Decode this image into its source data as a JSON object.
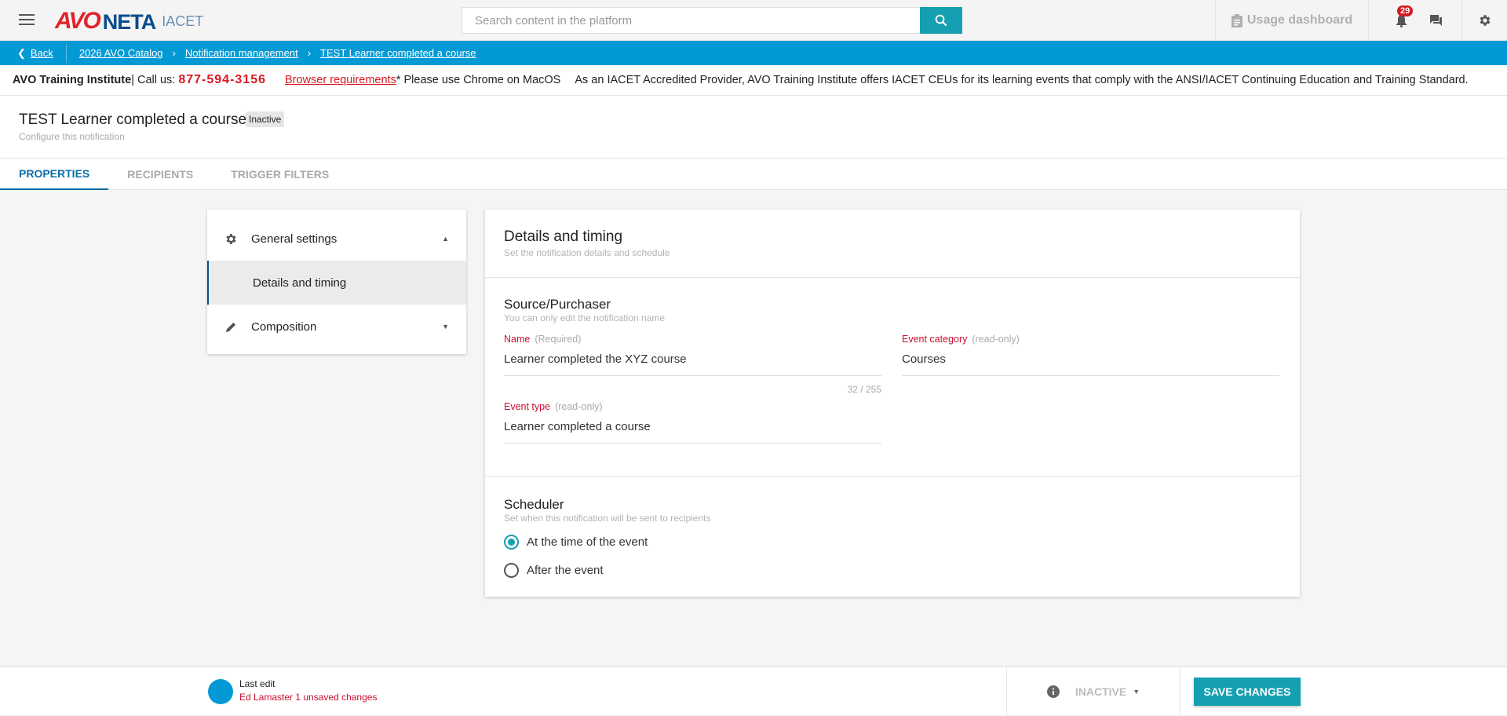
{
  "header": {
    "logo": "AVONETA IACET",
    "logo_avo": "AVO",
    "logo_neta": "NETA",
    "logo_iacet": "IACET",
    "search_placeholder": "Search content in the platform",
    "usage_dashboard": "Usage dashboard",
    "notifications_count": "29"
  },
  "breadcrumb": {
    "back": "Back",
    "items": [
      "2026 AVO Catalog",
      "Notification management",
      "TEST Learner completed a course"
    ]
  },
  "info": {
    "org": "AVO Training Institute",
    "call_label": "| Call us:",
    "phone": "877-594-3156",
    "browser_req": "Browser requirements",
    "browser_note": "* Please use Chrome on MacOS",
    "accreditation": "As an IACET Accredited Provider, AVO Training Institute offers IACET CEUs for its learning events that comply with the ANSI/IACET Continuing Education and Training Standard."
  },
  "page": {
    "title": "TEST Learner completed a course",
    "status": "Inactive",
    "subtitle": "Configure this notification"
  },
  "tabs": [
    {
      "label": "PROPERTIES"
    },
    {
      "label": "RECIPIENTS"
    },
    {
      "label": "TRIGGER FILTERS"
    }
  ],
  "sidebar": {
    "general": "General settings",
    "details": "Details and timing",
    "composition": "Composition"
  },
  "details": {
    "title": "Details and timing",
    "subtitle": "Set the notification details and schedule"
  },
  "source": {
    "title": "Source/Purchaser",
    "subtitle": "You can only edit the notification name",
    "name_label": "Name",
    "name_hint": "(Required)",
    "name_value": "Learner completed the XYZ course",
    "name_count": "32 / 255",
    "category_label": "Event category",
    "category_hint": "(read-only)",
    "category_value": "Courses",
    "type_label": "Event type",
    "type_hint": "(read-only)",
    "type_value": "Learner completed a course"
  },
  "scheduler": {
    "title": "Scheduler",
    "subtitle": "Set when this notification will be sent to recipients",
    "options": [
      "At the time of the event",
      "After the event"
    ],
    "selected": 0
  },
  "footer": {
    "last_edit": "Last edit",
    "unsaved": "Ed Lamaster 1 unsaved changes",
    "status": "INACTIVE",
    "save": "SAVE CHANGES"
  },
  "colors": {
    "accent": "#14a0b0",
    "brand_blue": "#0399d4",
    "required_red": "#c8102e"
  }
}
